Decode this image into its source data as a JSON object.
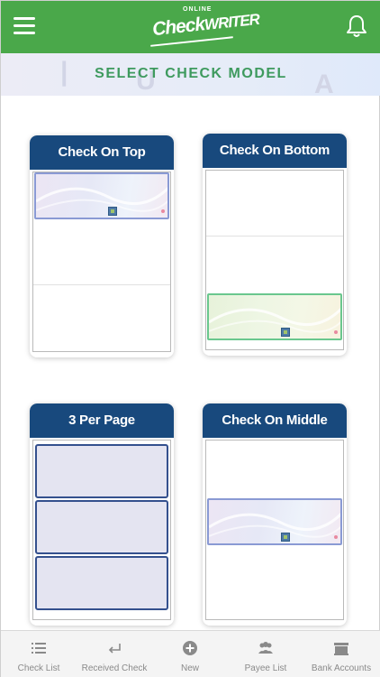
{
  "header": {
    "logo_small": "ONLINE",
    "logo_main_a": "Check",
    "logo_main_b": "WRITER"
  },
  "banner": {
    "title": "SELECT CHECK MODEL"
  },
  "cards": [
    {
      "label": "Check On Top"
    },
    {
      "label": "Check On Bottom"
    },
    {
      "label": "3 Per Page"
    },
    {
      "label": "Check On Middle"
    }
  ],
  "bottom_nav": [
    {
      "label": "Check List",
      "icon": "list-icon"
    },
    {
      "label": "Received Check",
      "icon": "return-arrow-icon"
    },
    {
      "label": "New",
      "icon": "plus-circle-icon"
    },
    {
      "label": "Payee List",
      "icon": "people-icon"
    },
    {
      "label": "Bank Accounts",
      "icon": "bank-icon"
    }
  ],
  "colors": {
    "header_green": "#4aa84a",
    "card_header_blue": "#18497d",
    "banner_text_green": "#3e9a5e"
  }
}
